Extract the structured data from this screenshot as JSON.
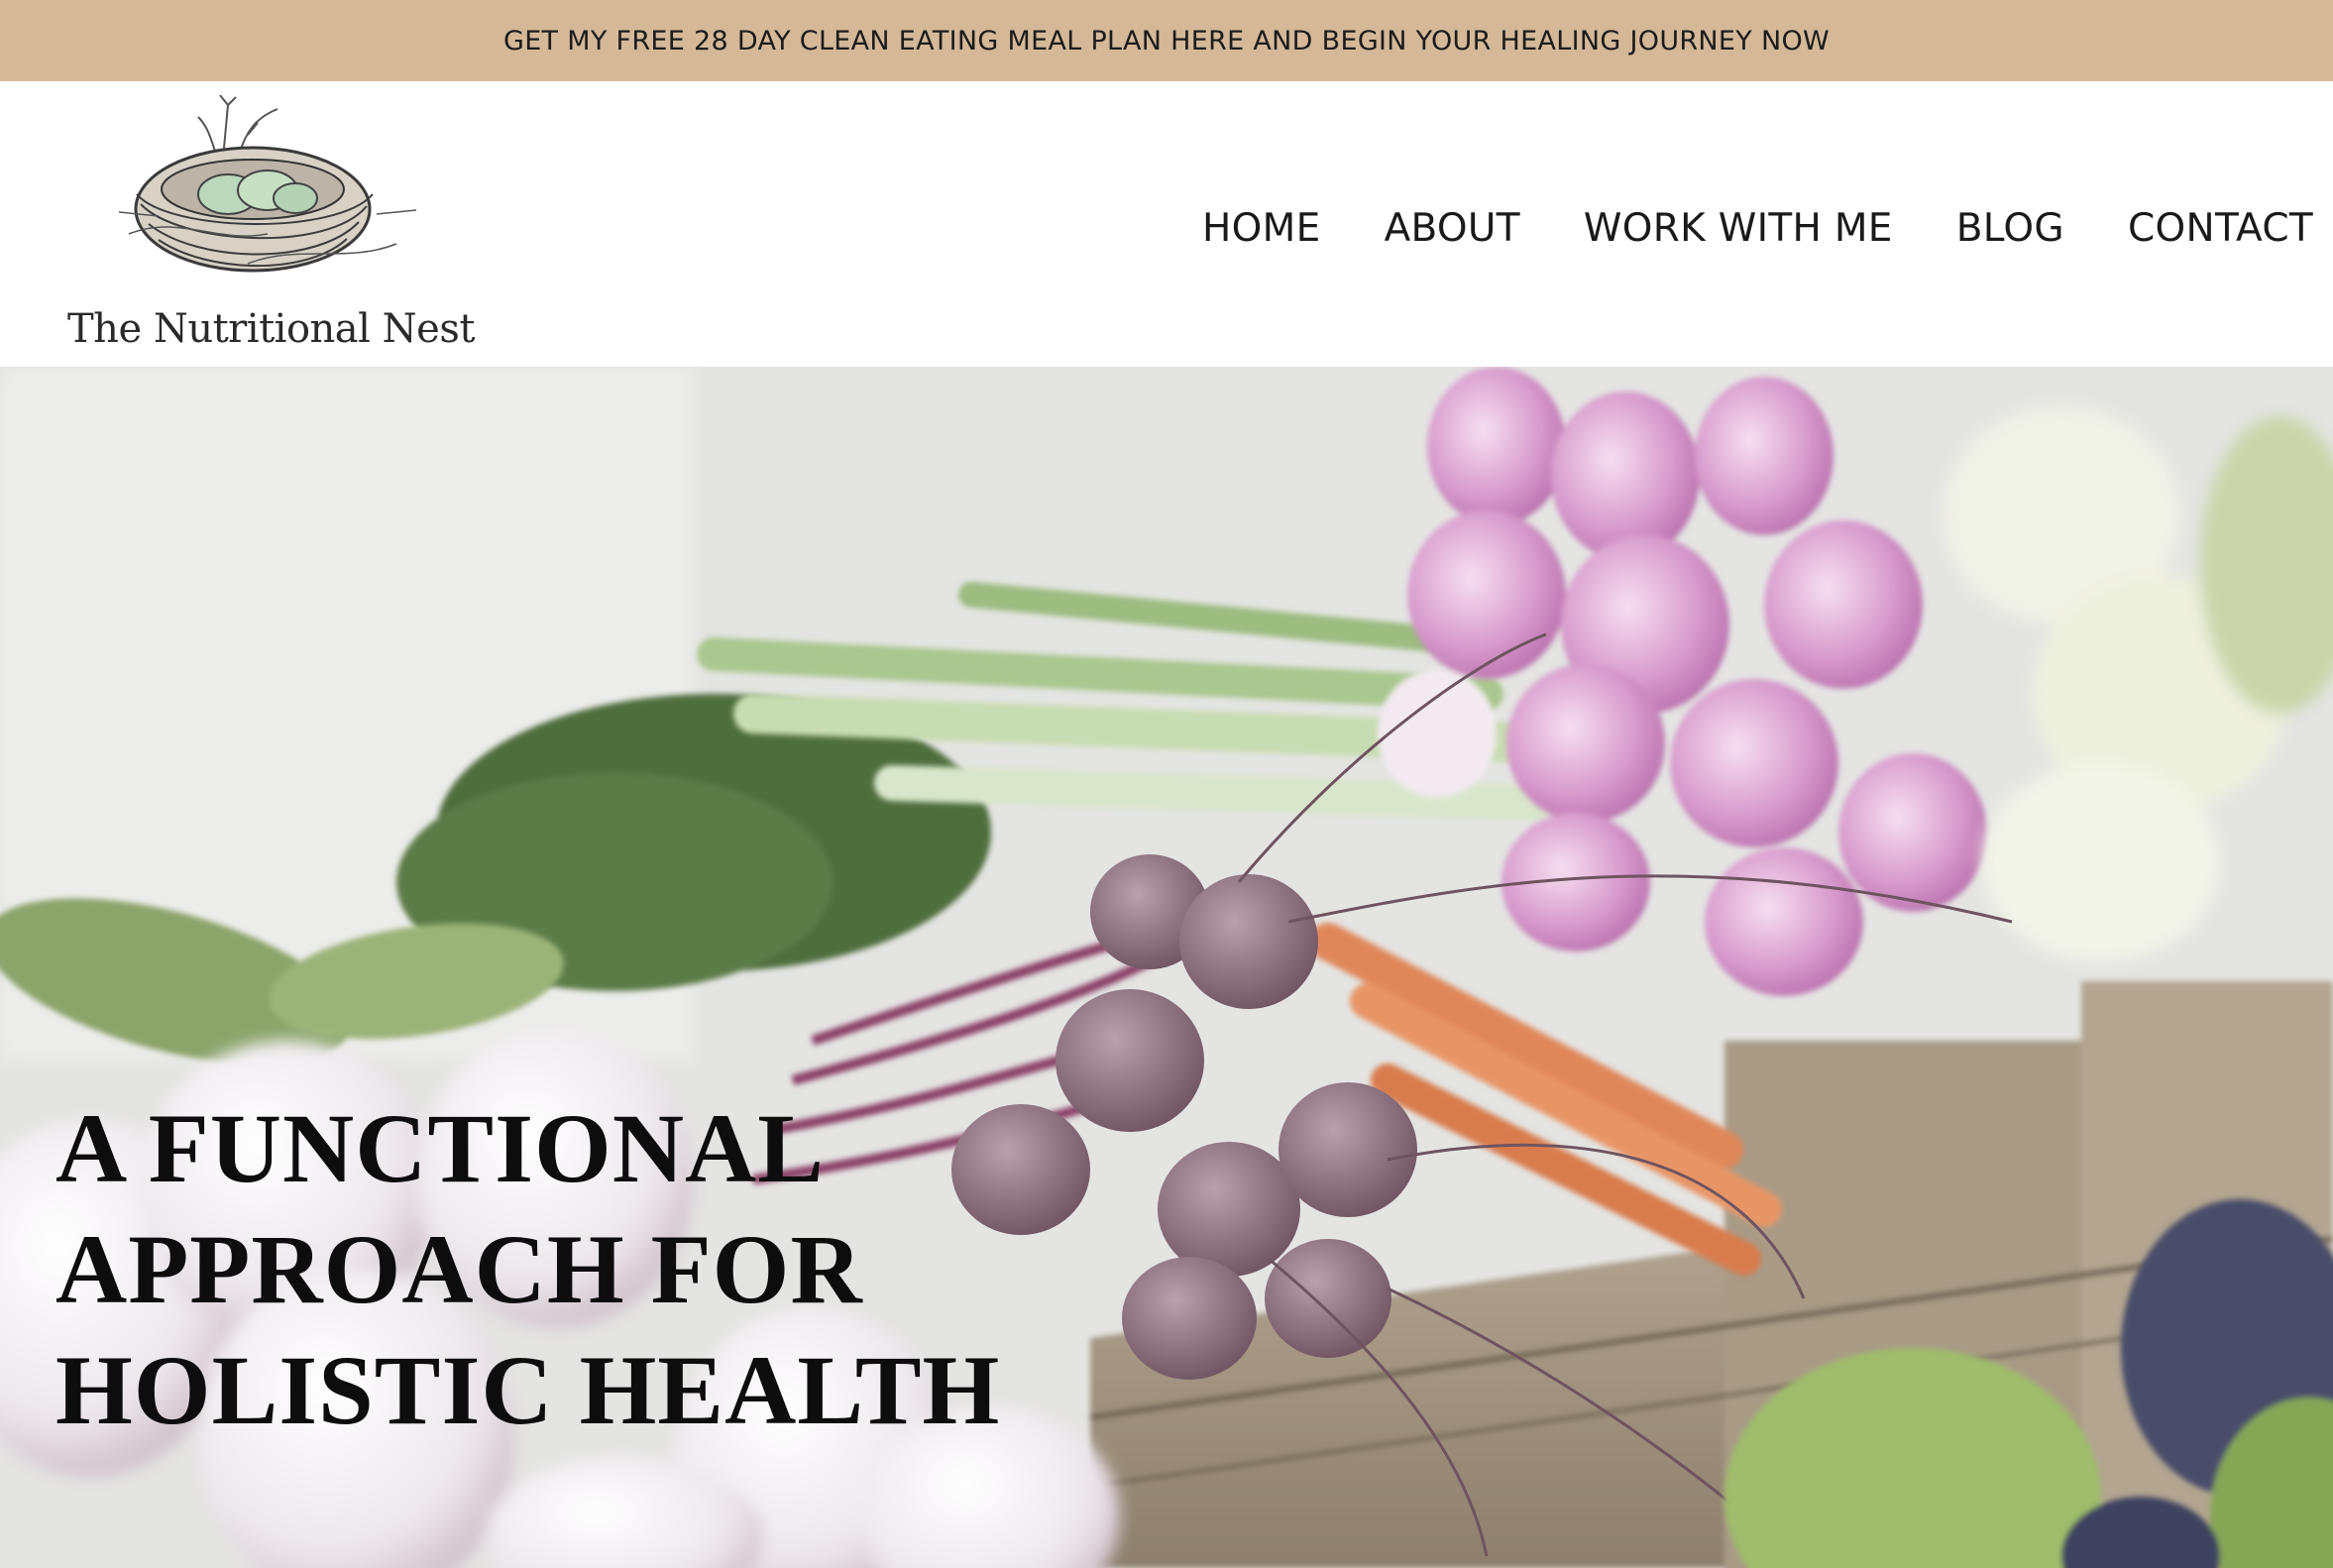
{
  "announcement": {
    "text": "GET MY FREE 28 DAY CLEAN EATING MEAL PLAN HERE AND BEGIN YOUR HEALING JOURNEY NOW"
  },
  "header": {
    "logo": {
      "text": "The Nutritional Nest",
      "icon": "nest-icon"
    },
    "nav": [
      {
        "label": "HOME"
      },
      {
        "label": "ABOUT"
      },
      {
        "label": "WORK WITH ME"
      },
      {
        "label": "BLOG"
      },
      {
        "label": "CONTACT"
      }
    ]
  },
  "hero": {
    "image": "vegetables-market-photo",
    "headline_lines": [
      "A FUNCTIONAL",
      "APPROACH FOR",
      "HOLISTIC HEALTH"
    ]
  },
  "colors": {
    "announcement_bg": "#d4b898",
    "text_dark": "#1a1a1a",
    "header_bg": "#ffffff"
  }
}
